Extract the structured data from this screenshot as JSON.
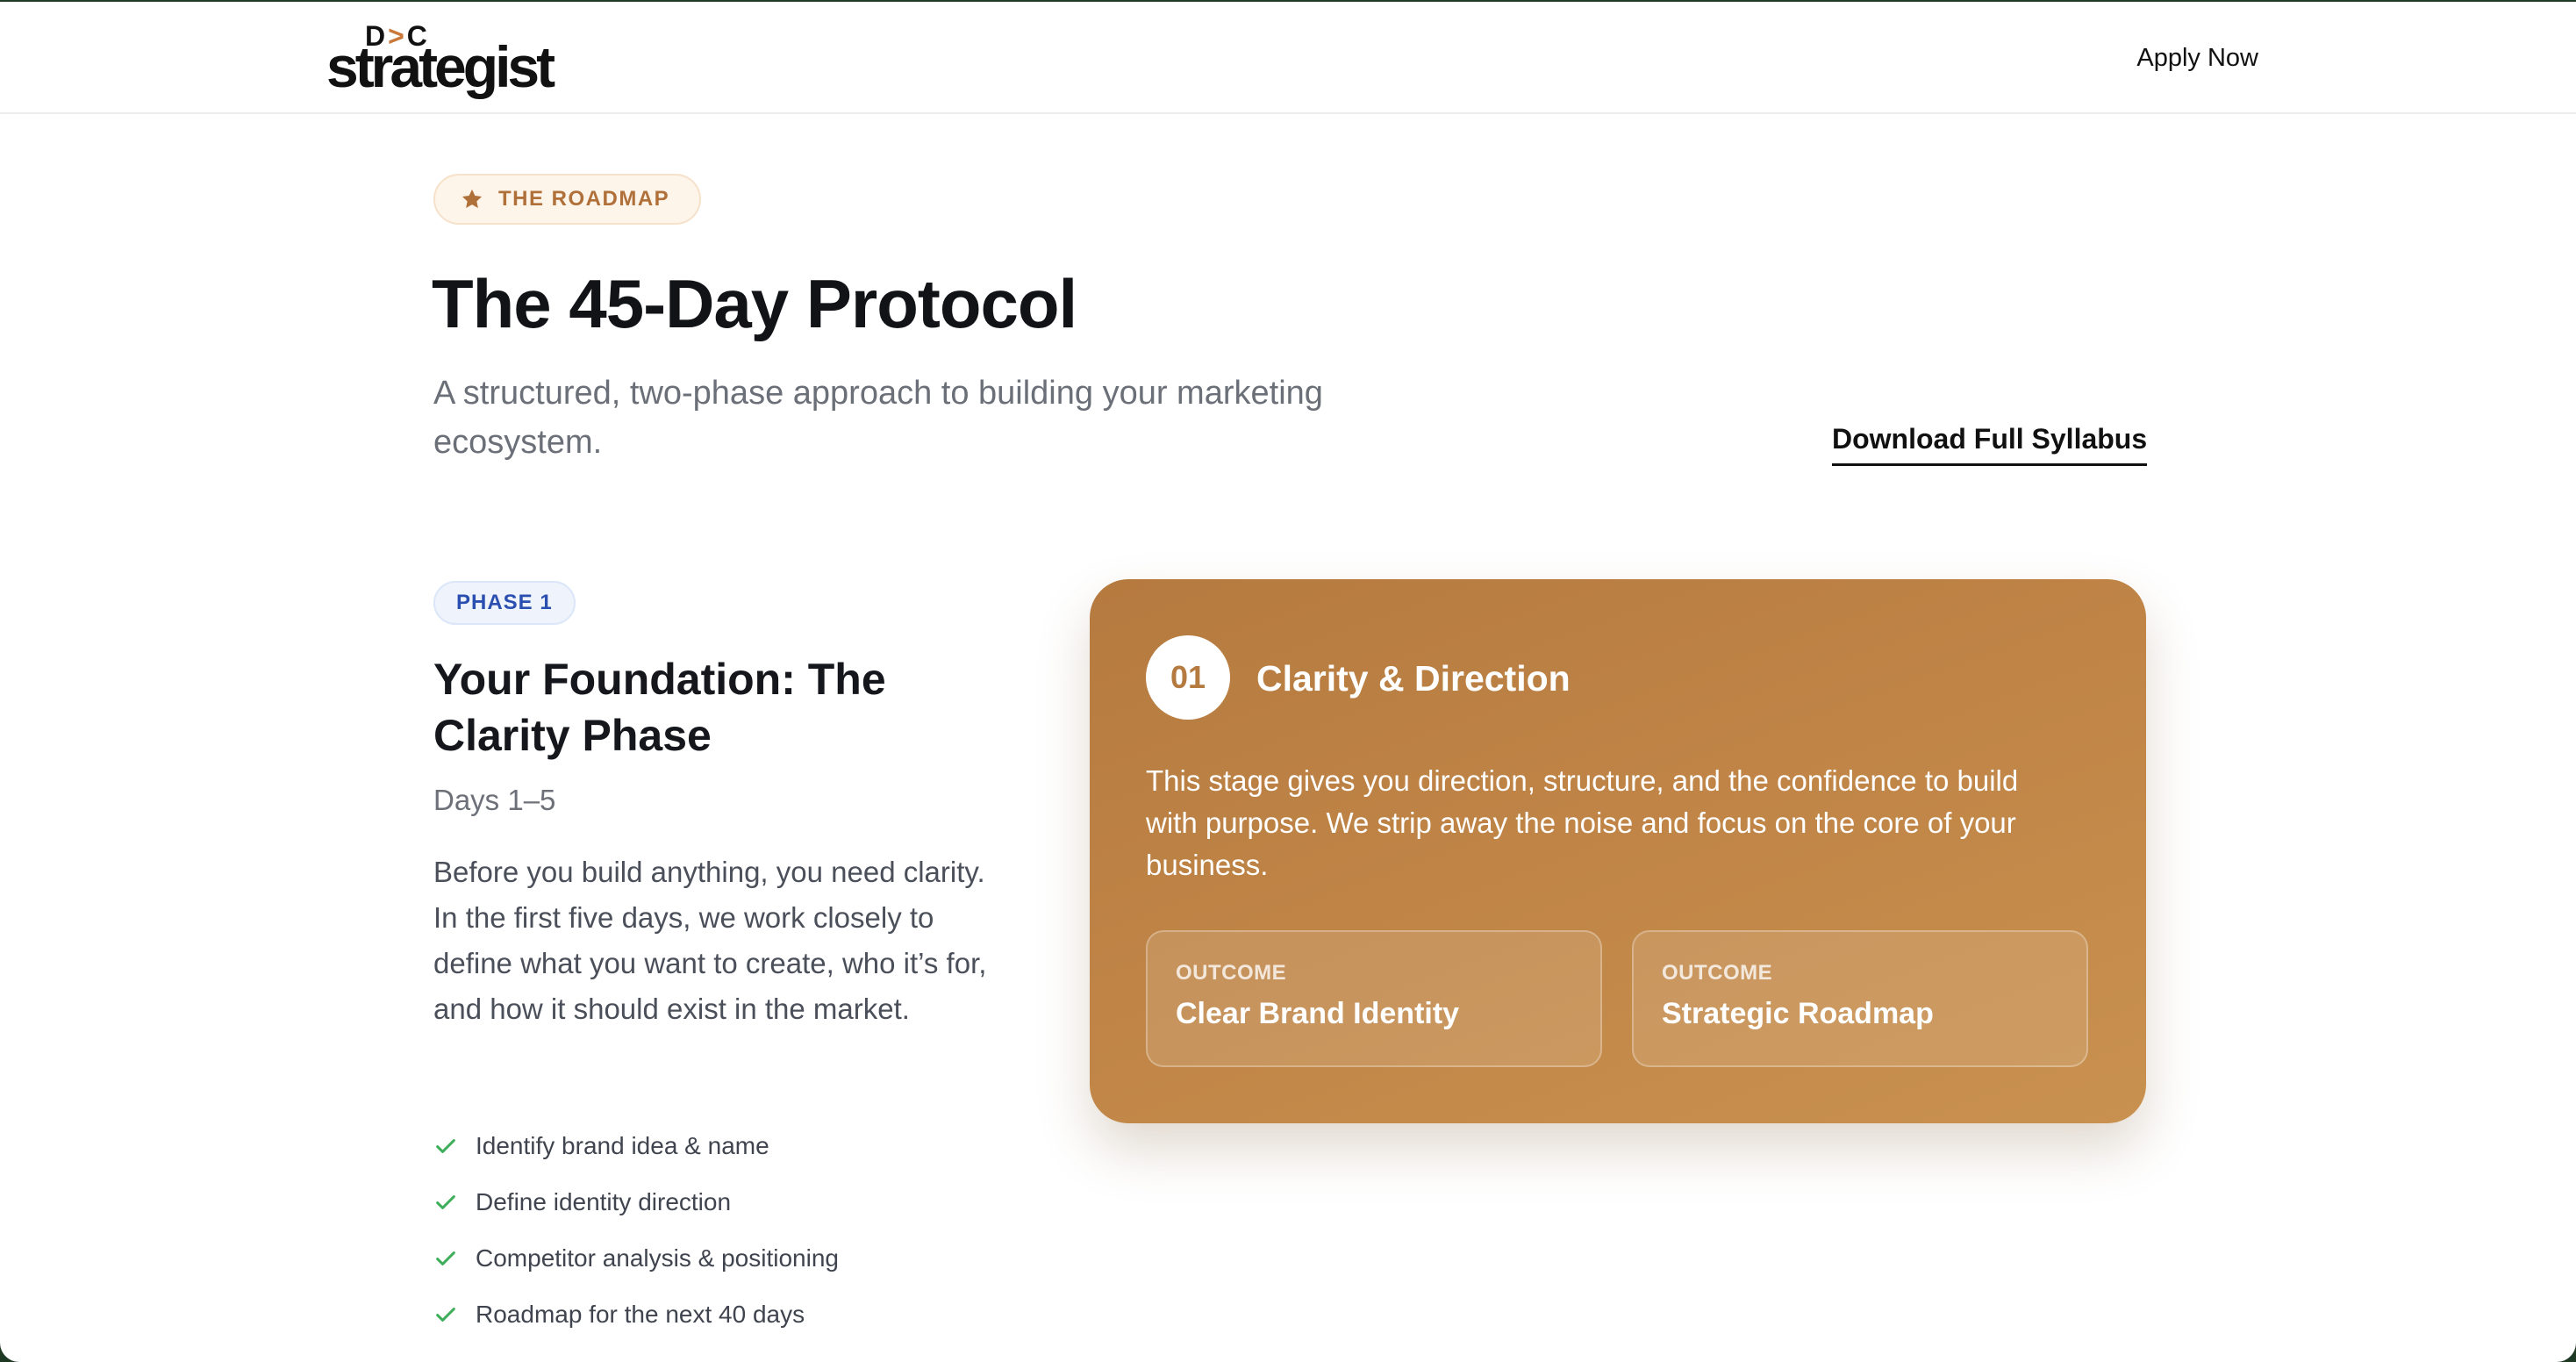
{
  "nav": {
    "logo_mark_left": "D",
    "logo_mark_chevron": ">",
    "logo_mark_right": "C",
    "logo_word": "strategist",
    "apply_label": "Apply Now"
  },
  "hero": {
    "badge_label": "THE ROADMAP",
    "badge_icon": "star-icon",
    "title": "The 45-Day Protocol",
    "subtitle": "A structured, two-phase approach to building your marketing ecosystem.",
    "download_label": "Download Full Syllabus"
  },
  "phase": {
    "badge": "PHASE 1",
    "title": "Your Foundation: The Clarity Phase",
    "days": "Days 1–5",
    "description": "Before you build anything, you need clarity. In the first five days, we work closely to define what you want to create, who it’s for, and how it should exist in the market.",
    "checklist": [
      "Identify brand idea & name",
      "Define identity direction",
      "Competitor analysis & positioning",
      "Roadmap for the next 40 days"
    ]
  },
  "card": {
    "number": "01",
    "title": "Clarity & Direction",
    "description": "This stage gives you direction, structure, and the confidence to build with purpose. We strip away the noise and focus on the core of your business.",
    "outcomes": [
      {
        "label": "OUTCOME",
        "value": "Clear Brand Identity"
      },
      {
        "label": "OUTCOME",
        "value": "Strategic Roadmap"
      }
    ]
  },
  "colors": {
    "accent": "#b57a3f",
    "badge_text": "#b0703a",
    "phase_blue": "#2b4fb0",
    "check_green": "#3fae5a"
  }
}
